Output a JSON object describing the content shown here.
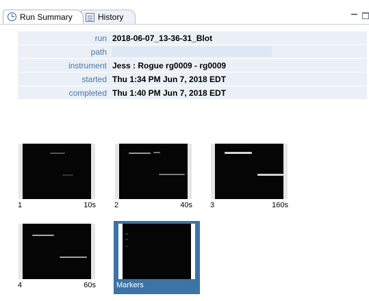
{
  "tabs": [
    {
      "label": "Run Summary",
      "icon": "clock-icon",
      "active": true
    },
    {
      "label": "History",
      "icon": "history-icon",
      "active": false
    }
  ],
  "summary": {
    "fields": [
      {
        "key": "run",
        "value": "2018-06-07_13-36-31_Blot"
      },
      {
        "key": "path",
        "value": ""
      },
      {
        "key": "instrument",
        "value": "Jess : Rogue rg0009 - rg0009"
      },
      {
        "key": "started",
        "value": "Thu 1:34 PM Jun 7, 2018 EDT"
      },
      {
        "key": "completed",
        "value": "Thu 1:40 PM Jun 7, 2018 EDT"
      }
    ]
  },
  "thumbnails": [
    {
      "label": "1",
      "time": "10s",
      "selected": false
    },
    {
      "label": "2",
      "time": "40s",
      "selected": false
    },
    {
      "label": "3",
      "time": "160s",
      "selected": false
    },
    {
      "label": "4",
      "time": "60s",
      "selected": false
    },
    {
      "label": "Markers",
      "time": "",
      "selected": true
    }
  ],
  "colors": {
    "label_blue": "#4a76a8",
    "row_bg": "#eaf0f6",
    "selection": "#3c74a6"
  }
}
